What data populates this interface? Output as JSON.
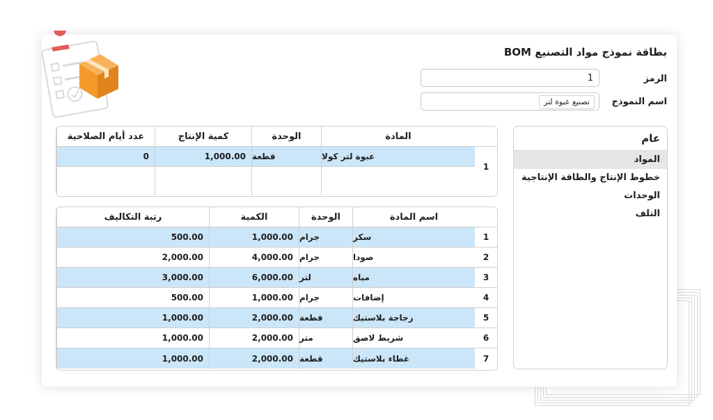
{
  "form": {
    "title": "بطاقة نموذج مواد التصنيع BOM",
    "code_label": "الرمز",
    "code_value": "1",
    "model_name_label": "اسم النموذج",
    "model_name_value": "تصنيع عبوة لتر"
  },
  "sidebar": {
    "header": "عام",
    "items": [
      {
        "label": "المواد",
        "active": true
      },
      {
        "label": "خطوط الإنتاج والطاقة الإنتاجية",
        "active": false
      },
      {
        "label": "الوحدات",
        "active": false
      },
      {
        "label": "التلف",
        "active": false
      }
    ]
  },
  "product_table": {
    "headers": {
      "material": "المادة",
      "unit": "الوحدة",
      "production_qty": "كمية الإنتاج",
      "shelf_days": "عدد أيام الصلاحية"
    },
    "rows": [
      {
        "index": "1",
        "material": "عبوة لتر كولا",
        "unit": "قطعة",
        "production_qty": "1,000.00",
        "shelf_days": "0"
      }
    ]
  },
  "materials_table": {
    "headers": {
      "name": "اسم المادة",
      "unit": "الوحدة",
      "qty": "الكمية",
      "cost_rank": "رتبة التكاليف"
    },
    "rows": [
      {
        "index": "1",
        "name": "سكر",
        "unit": "جرام",
        "qty": "1,000.00",
        "cost_rank": "500.00"
      },
      {
        "index": "2",
        "name": "صودا",
        "unit": "جرام",
        "qty": "4,000.00",
        "cost_rank": "2,000.00"
      },
      {
        "index": "3",
        "name": "مياه",
        "unit": "لتر",
        "qty": "6,000.00",
        "cost_rank": "3,000.00"
      },
      {
        "index": "4",
        "name": "إضافات",
        "unit": "جرام",
        "qty": "1,000.00",
        "cost_rank": "500.00"
      },
      {
        "index": "5",
        "name": "زجاجة بلاستيك",
        "unit": "قطعة",
        "qty": "2,000.00",
        "cost_rank": "1,000.00"
      },
      {
        "index": "6",
        "name": "شريط لاصق",
        "unit": "متر",
        "qty": "2,000.00",
        "cost_rank": "1,000.00"
      },
      {
        "index": "7",
        "name": "غطاء بلاستيك",
        "unit": "قطعة",
        "qty": "2,000.00",
        "cost_rank": "1,000.00"
      }
    ]
  },
  "colors": {
    "row_highlight": "#cbe6f9",
    "logo_orange": "#f39a2b",
    "logo_pin": "#e25d58"
  },
  "icons": {
    "logo": "clipboard-box-icon"
  }
}
